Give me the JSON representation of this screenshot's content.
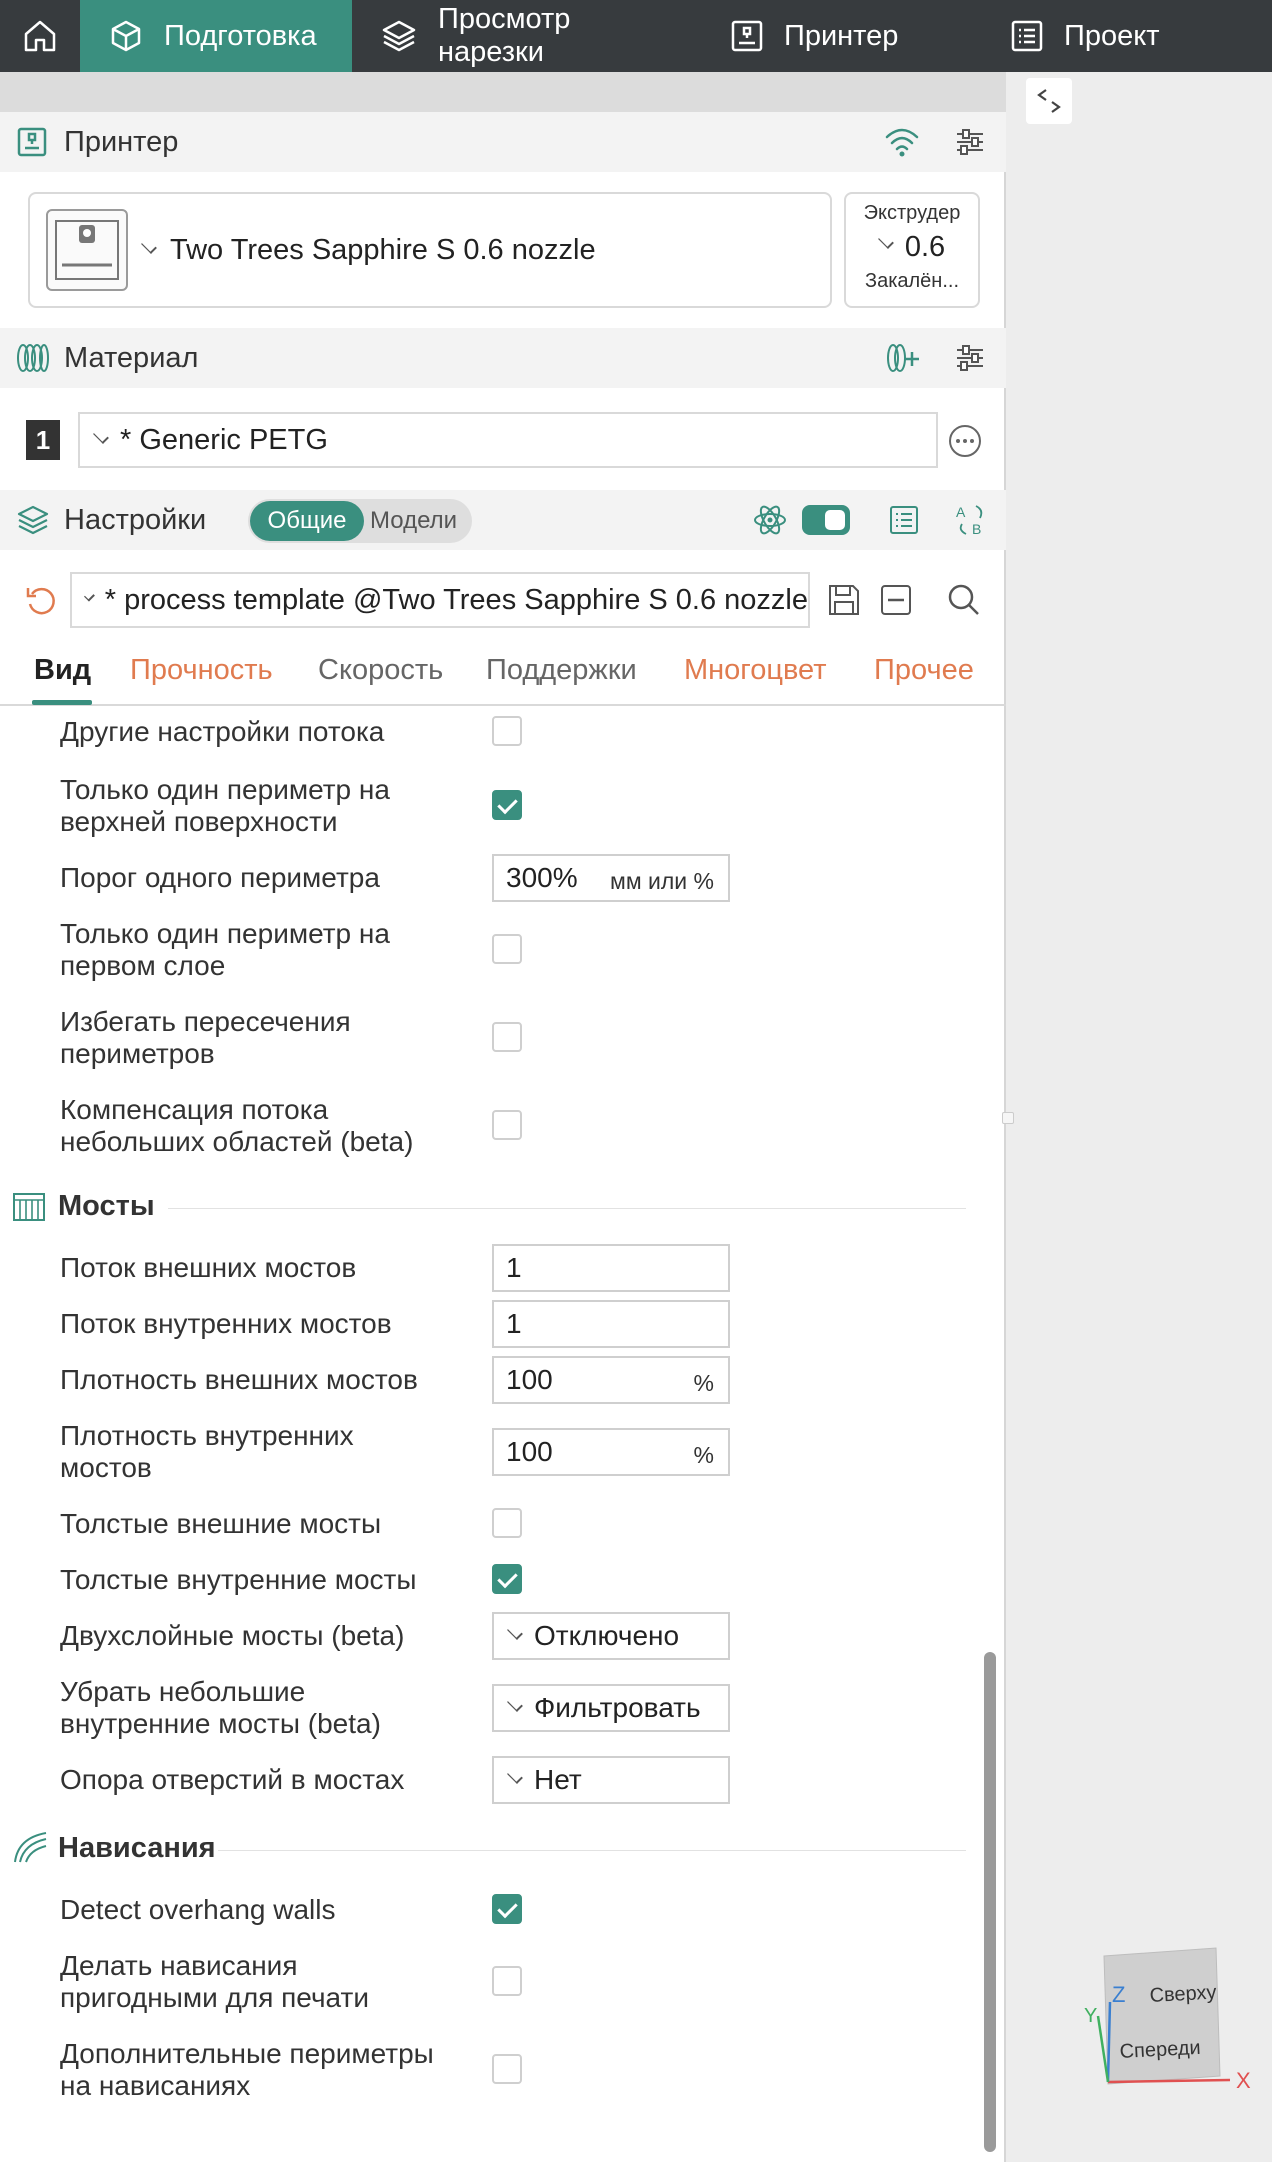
{
  "nav": {
    "tabs": [
      {
        "label": "Подготовка",
        "active": true
      },
      {
        "label": "Просмотр нарезки",
        "active": false
      },
      {
        "label": "Принтер",
        "active": false
      },
      {
        "label": "Проект",
        "active": false
      }
    ]
  },
  "printer": {
    "section_title": "Принтер",
    "name": "Two Trees Sapphire S 0.6 nozzle",
    "extruder_label": "Экструдер",
    "extruder_value": "0.6",
    "extruder_sub": "Закалён..."
  },
  "material": {
    "section_title": "Материал",
    "slot_number": "1",
    "filament": "* Generic PETG"
  },
  "settings": {
    "section_title": "Настройки",
    "toggle_global": "Общие",
    "toggle_models": "Модели",
    "process": "* process template @Two Trees Sapphire S 0.6 nozzle",
    "tabs": [
      "Вид",
      "Прочность",
      "Скорость",
      "Поддержки",
      "Многоцвет",
      "Прочее"
    ]
  },
  "rows": {
    "other_flow": "Другие настройки потока",
    "only_one_wall_top_1": "Только один периметр на",
    "only_one_wall_top_2": "верхней поверхности",
    "one_wall_threshold": "Порог одного периметра",
    "one_wall_threshold_value": "300%",
    "one_wall_threshold_unit": "мм или %",
    "only_one_wall_first_1": "Только один периметр на",
    "only_one_wall_first_2": "первом слое",
    "avoid_crossing_1": "Избегать пересечения",
    "avoid_crossing_2": "периметров",
    "small_area_flow_1": "Компенсация потока",
    "small_area_flow_2": "небольших областей (beta)"
  },
  "bridges": {
    "title": "Мосты",
    "external_flow": "Поток внешних мостов",
    "external_flow_value": "1",
    "internal_flow": "Поток внутренних мостов",
    "internal_flow_value": "1",
    "external_density": "Плотность внешних мостов",
    "external_density_value": "100",
    "internal_density_1": "Плотность внутренних",
    "internal_density_2": "мостов",
    "internal_density_value": "100",
    "percent": "%",
    "thick_external": "Толстые внешние мосты",
    "thick_internal": "Толстые внутренние мосты",
    "double_layer": "Двухслойные мосты (beta)",
    "double_layer_value": "Отключено",
    "filter_small_1": "Убрать небольшие",
    "filter_small_2": "внутренние мосты (beta)",
    "filter_small_value": "Фильтровать",
    "hole_support": "Опора отверстий в мостах",
    "hole_support_value": "Нет"
  },
  "overhangs": {
    "title": "Нависания",
    "detect_walls": "Detect overhang walls",
    "make_printable_1": "Делать нависания",
    "make_printable_2": "пригодными для печати",
    "extra_perimeters_1": "Дополнительные периметры",
    "extra_perimeters_2": "на нависаниях"
  },
  "viewport": {
    "cube_top": "Сверху",
    "cube_front": "Спереди",
    "axis_x": "X",
    "axis_y": "Y",
    "axis_z": "Z"
  },
  "colors": {
    "accent": "#3a8f7f",
    "orange_tab": "#e07b4f",
    "topbar": "#373b3e"
  }
}
